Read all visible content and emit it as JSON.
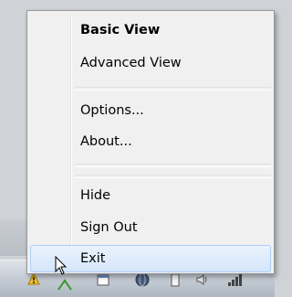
{
  "menu": {
    "items": [
      {
        "label": "Basic View"
      },
      {
        "label": "Advanced View"
      },
      {
        "label": "Options..."
      },
      {
        "label": "About..."
      },
      {
        "label": "Hide"
      },
      {
        "label": "Sign Out"
      },
      {
        "label": "Exit"
      }
    ]
  },
  "tray": {
    "icons": [
      "warning-bell-icon",
      "mouse-cursor-icon",
      "window-icon",
      "globe-icon",
      "battery-icon",
      "sound-icon",
      "signal-icon"
    ]
  },
  "colors": {
    "menu_bg": "#f0f0f0",
    "hover_bg": "#d5e6fb",
    "hover_border": "#aecff7",
    "taskbar": "#c7ced7"
  }
}
